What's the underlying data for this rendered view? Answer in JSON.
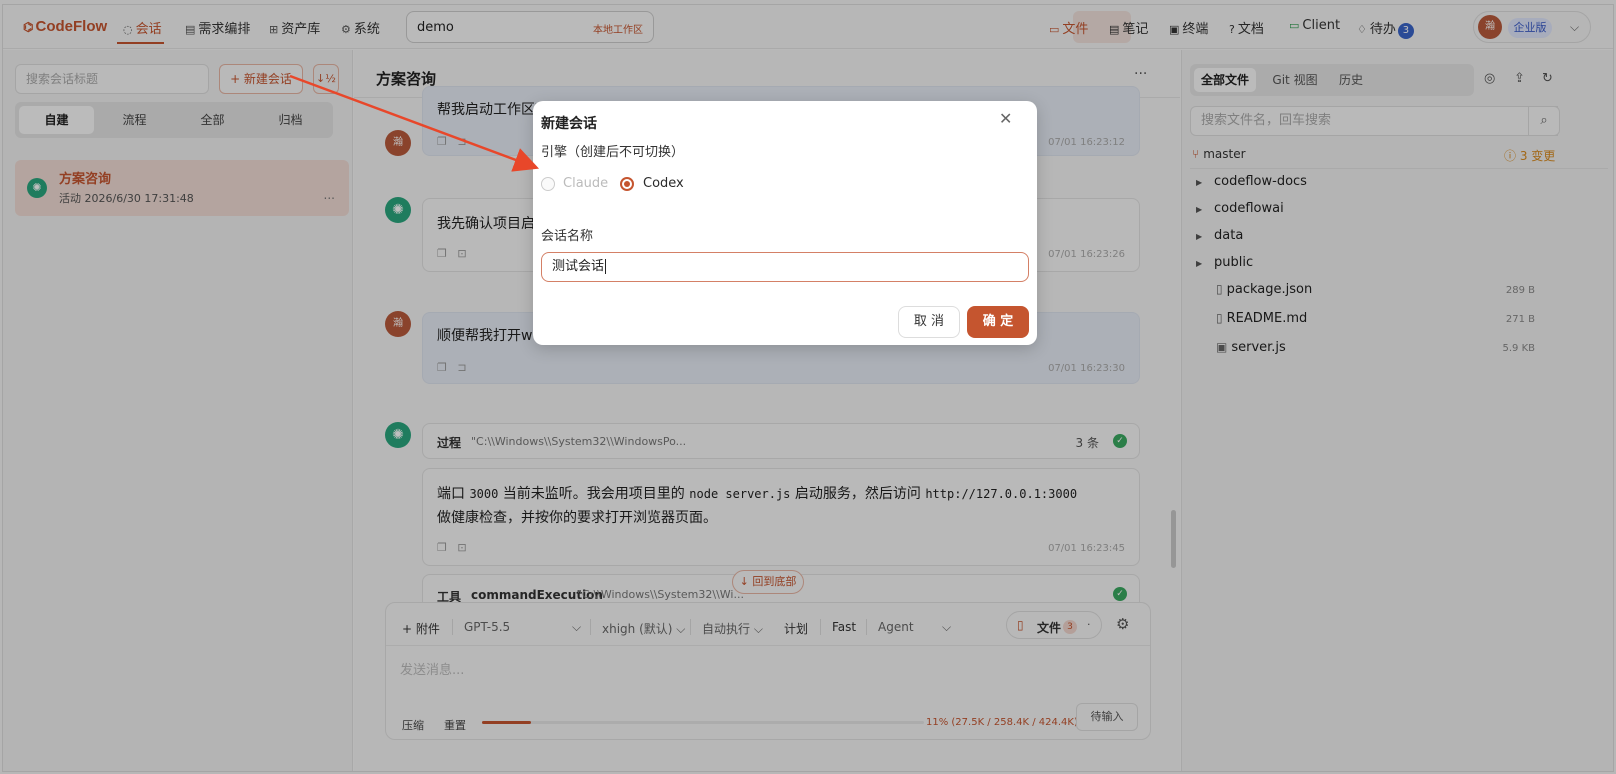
{
  "topbar": {
    "logo": "CodeFlow",
    "nav": [
      {
        "label": "会话",
        "icon": "chat-icon",
        "active": true
      },
      {
        "label": "需求编排",
        "icon": "doc-icon",
        "active": false
      },
      {
        "label": "资产库",
        "icon": "network-icon",
        "active": false
      },
      {
        "label": "系统",
        "icon": "gear-icon",
        "active": false
      }
    ],
    "workspace": {
      "name": "demo",
      "tag": "本地工作区"
    },
    "right_nav": [
      {
        "label": "文件",
        "icon": "folder-icon",
        "active": true
      },
      {
        "label": "笔记",
        "icon": "note-icon",
        "active": false
      },
      {
        "label": "终端",
        "icon": "terminal-icon",
        "active": false
      },
      {
        "label": "文档",
        "icon": "help-icon",
        "active": false
      },
      {
        "label": "Client",
        "icon": "monitor-icon",
        "active": false
      },
      {
        "label": "待办",
        "icon": "bell-icon",
        "active": false,
        "badge": "3"
      }
    ],
    "user": {
      "avatar": "瀚",
      "edition": "企业版"
    }
  },
  "sidebar": {
    "search_placeholder": "搜索会话标题",
    "new_button": "+ 新建会话",
    "sort_label": "↓½",
    "tabs": [
      "自建",
      "流程",
      "全部",
      "归档"
    ],
    "active_tab": 0,
    "sessions": [
      {
        "title": "方案咨询",
        "activity": "活动 2026/6/30 17:31:48",
        "more": "..."
      }
    ]
  },
  "chat": {
    "title": "方案咨询",
    "more": "···",
    "messages": [
      {
        "role": "user",
        "avatar": "瀚",
        "text": "帮我启动工作区项目",
        "time": "07/01 16:23:12"
      },
      {
        "role": "bot",
        "text": "我先确认项目启动方式，检查现有端口和服务状态，避免重复启动多个进程。",
        "time": "07/01 16:23:26"
      },
      {
        "role": "user",
        "avatar": "瀚",
        "text": "顺便帮我打开web页面",
        "time": "07/01 16:23:30"
      }
    ],
    "process": {
      "label": "过程",
      "path": "\"C:\\\\Windows\\\\System32\\\\WindowsPo...",
      "count": "3 条"
    },
    "long_message": {
      "line1_a": "端口 ",
      "line1_code1": "3000",
      "line1_b": " 当前未监听。我会用项目里的 ",
      "line1_code2": "node server.js",
      "line1_c": " 启动服务，然后访问 ",
      "line1_code3": "http://127.0.0.1:3000",
      "line2": "做健康检查，并按你的要求打开浏览器页面。",
      "time": "07/01 16:23:45"
    },
    "tool": {
      "label": "工具",
      "name": "commandExecution",
      "path": "\"C:\\\\Windows\\\\System32\\\\Wi..."
    },
    "back_to_bottom": "↓ 回到底部"
  },
  "composer": {
    "attach": "+ 附件",
    "model": "GPT-5.5",
    "effort": "xhigh (默认)",
    "auto_exec": "自动执行",
    "plan": "计划",
    "fast": "Fast",
    "agent": "Agent",
    "file_chip": {
      "label": "文件",
      "count": "3",
      "caret": "·"
    },
    "placeholder": "发送消息...",
    "compress": "压缩",
    "reset": "重置",
    "context_usage": "11% (27.5K / 258.4K / 424.4K)",
    "context_fraction": 0.11,
    "wait_button": "待输入"
  },
  "files": {
    "tabs": [
      "全部文件",
      "Git 视图",
      "历史"
    ],
    "search_placeholder": "搜索文件名，回车搜索",
    "branch": "master",
    "changes": "3 变更",
    "tree": [
      {
        "name": "codeflow-docs",
        "type": "folder"
      },
      {
        "name": "codeflowai",
        "type": "folder"
      },
      {
        "name": "data",
        "type": "folder"
      },
      {
        "name": "public",
        "type": "folder"
      },
      {
        "name": "package.json",
        "type": "file",
        "size": "289 B"
      },
      {
        "name": "README.md",
        "type": "file",
        "size": "271 B"
      },
      {
        "name": "server.js",
        "type": "file",
        "size": "5.9 KB"
      }
    ]
  },
  "modal": {
    "title": "新建会话",
    "close": "✕",
    "engine_label": "引擎（创建后不可切换）",
    "engines": [
      {
        "name": "Claude",
        "disabled": true,
        "selected": false
      },
      {
        "name": "Codex",
        "disabled": false,
        "selected": true
      }
    ],
    "name_label": "会话名称",
    "name_value": "测试会话",
    "cancel": "取 消",
    "confirm": "确 定"
  },
  "colors": {
    "accent": "#c5552f",
    "bot": "#2aa67e",
    "ok": "#3aa860",
    "link": "#3a64c8"
  }
}
